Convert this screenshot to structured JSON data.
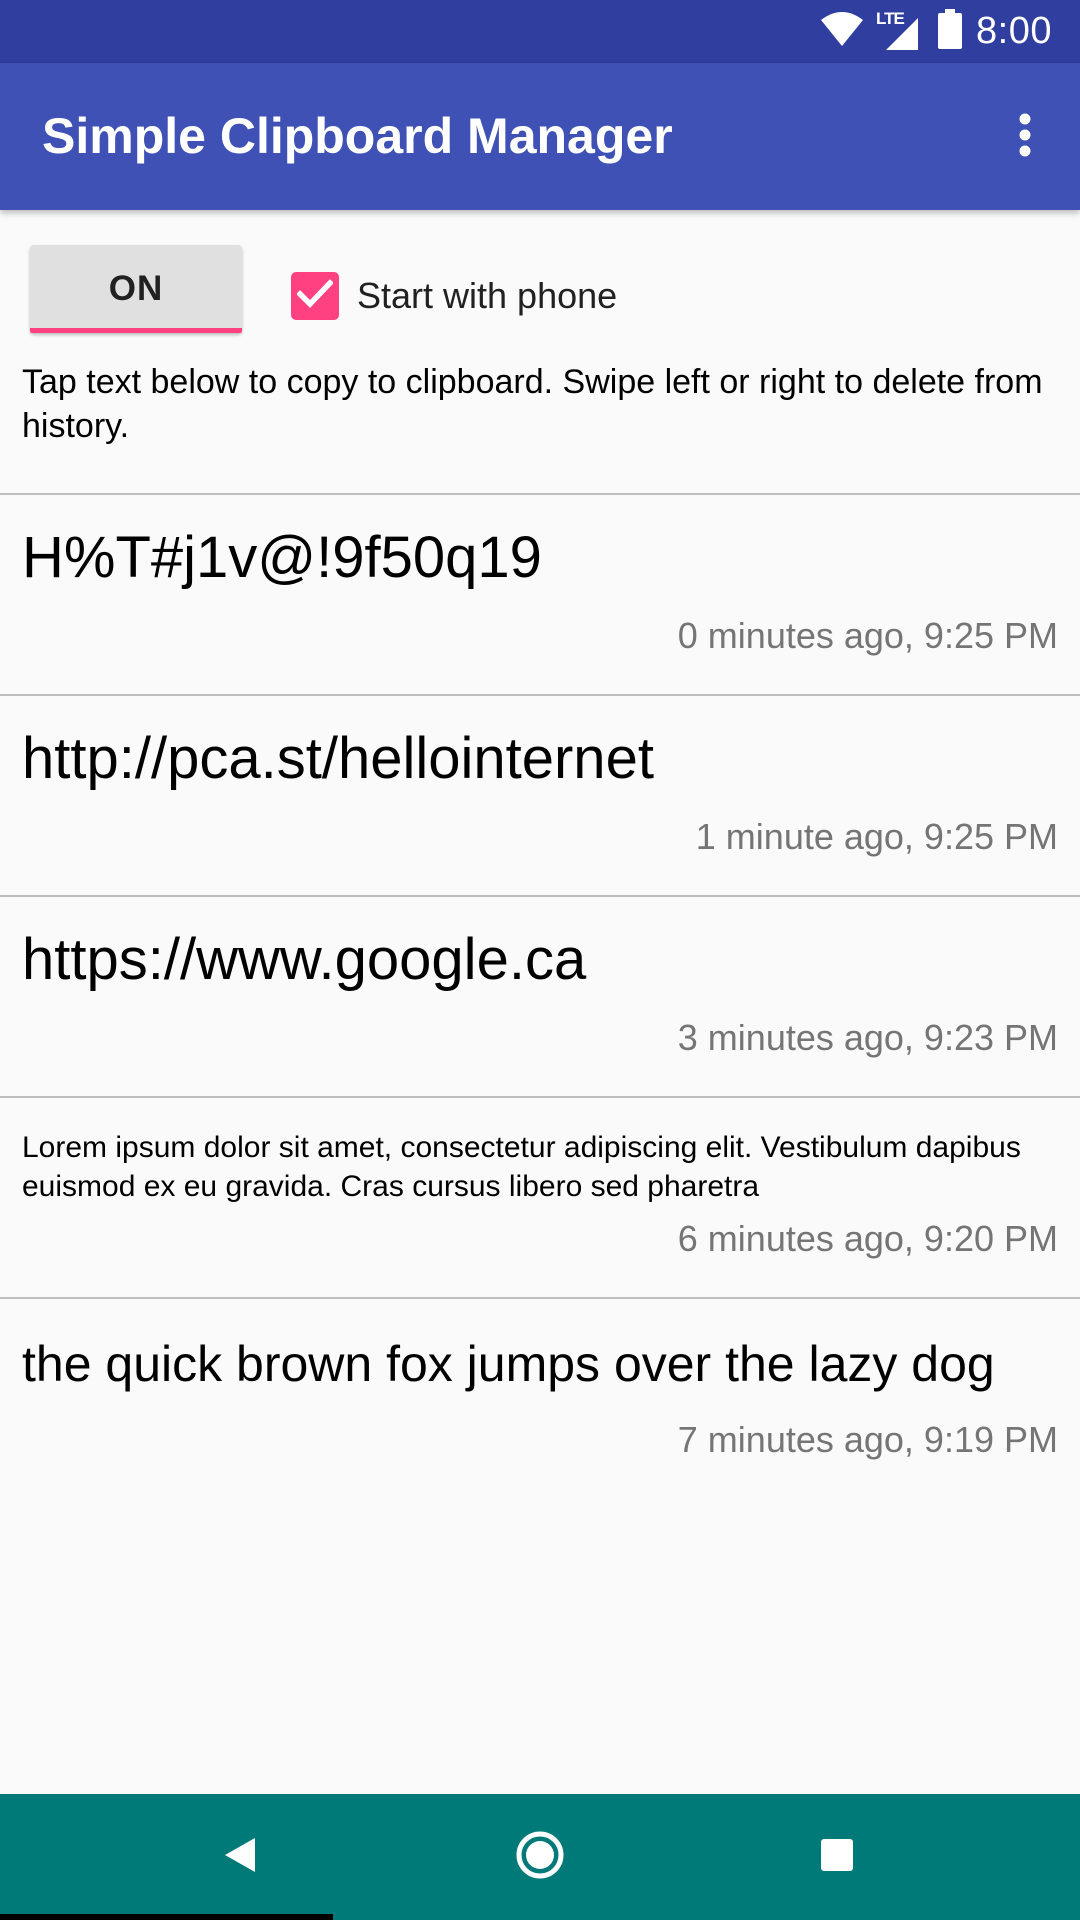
{
  "status_bar": {
    "time": "8:00",
    "network_label": "LTE",
    "icons": [
      "wifi-icon",
      "cell-signal-icon",
      "battery-icon"
    ]
  },
  "app_bar": {
    "title": "Simple Clipboard Manager",
    "overflow_icon": "more-vert-icon"
  },
  "controls": {
    "toggle_label": "ON",
    "start_with_phone_label": "Start with phone",
    "start_with_phone_checked": true
  },
  "instructions": "Tap text below to copy to clipboard. Swipe left or right to delete from history.",
  "clips": [
    {
      "text": "H%T#j1v@!9f50q19",
      "time": "0 minutes ago, 9:25 PM"
    },
    {
      "text": "http://pca.st/hellointernet",
      "time": "1 minute ago, 9:25 PM"
    },
    {
      "text": "https://www.google.ca",
      "time": "3 minutes ago, 9:23 PM"
    },
    {
      "text": "Lorem ipsum dolor sit amet, consectetur adipiscing elit. Vestibulum dapibus euismod ex eu gravida. Cras cursus libero sed pharetra",
      "time": "6 minutes ago, 9:20 PM"
    },
    {
      "text": "the quick brown fox jumps over the lazy dog",
      "time": "7 minutes ago, 9:19 PM"
    }
  ],
  "nav_bar": {
    "icons": [
      "back-icon",
      "home-icon",
      "recents-icon"
    ]
  },
  "colors": {
    "status_bar": "#303f9f",
    "app_bar": "#3f51b5",
    "accent": "#ff4081",
    "nav_bar": "#007a78"
  }
}
